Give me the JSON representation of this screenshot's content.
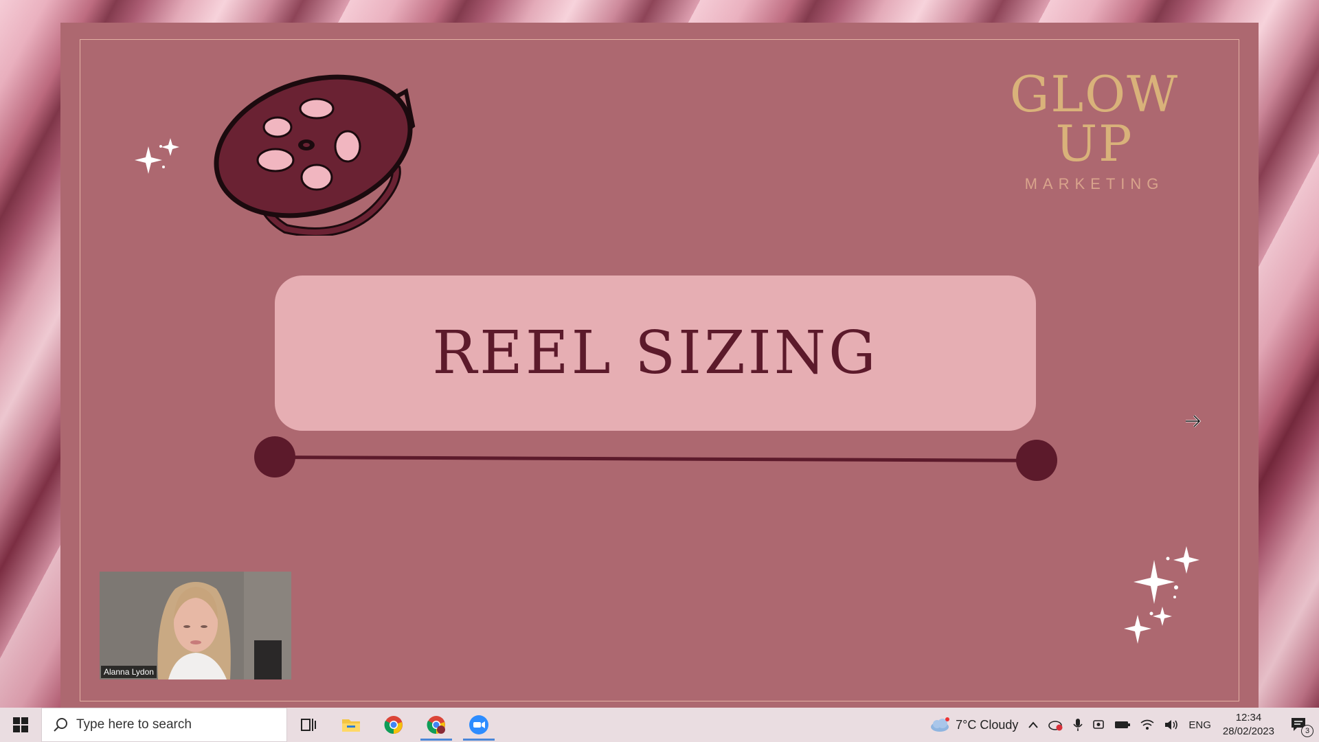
{
  "slide": {
    "title": "REEL SIZING",
    "logo_main": "GLOW UP",
    "logo_sub": "MARKETING"
  },
  "webcam": {
    "participant_name": "Alanna Lydon"
  },
  "taskbar": {
    "search_placeholder": "Type here to search",
    "apps": [
      "task-view",
      "file-explorer",
      "chrome",
      "chrome-profile",
      "zoom"
    ],
    "weather": "7°C  Cloudy",
    "language": "ENG",
    "time": "12:34",
    "date": "28/02/2023",
    "notification_count": "3"
  },
  "colors": {
    "slide_bg": "#ad6870",
    "title_box": "#e6aeb3",
    "dark_accent": "#5c1a2b",
    "logo_gold": "#d9b27a"
  }
}
